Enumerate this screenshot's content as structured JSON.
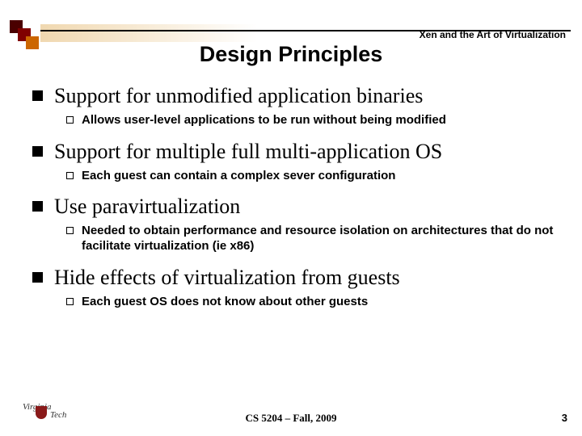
{
  "header": {
    "running_title": "Xen and the Art of Virtualization"
  },
  "title": "Design Principles",
  "items": [
    {
      "main": "Support for unmodified application binaries",
      "sub": "Allows user-level applications to be run without being modified"
    },
    {
      "main": "Support for multiple full multi-application OS",
      "sub": "Each guest can contain a complex sever configuration"
    },
    {
      "main": "Use paravirtualization",
      "sub": "Needed to obtain performance and resource isolation on architectures that do not facilitate virtualization (ie x86)"
    },
    {
      "main": "Hide effects of virtualization from guests",
      "sub": "Each guest OS does not know about other guests"
    }
  ],
  "footer": {
    "center": "CS 5204 – Fall, 2009",
    "page": "3",
    "logo_top": "Virginia",
    "logo_bottom": "Tech"
  }
}
